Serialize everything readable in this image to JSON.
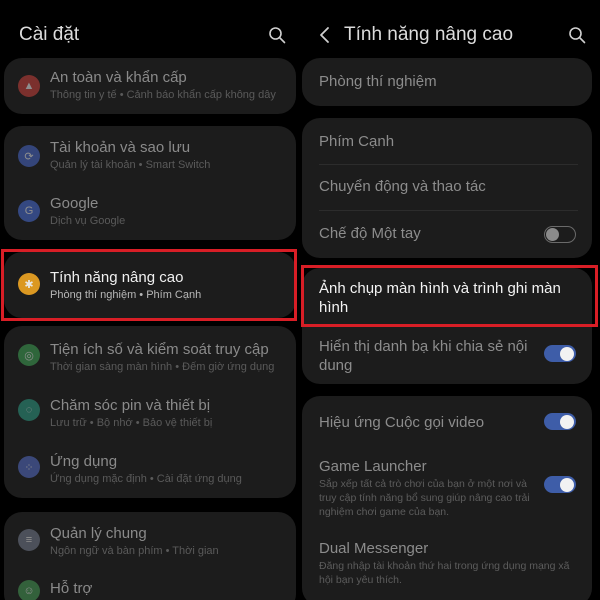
{
  "left": {
    "title": "Cài đặt",
    "items": [
      {
        "title": "An toàn và khẩn cấp",
        "subtitle": "Thông tin y tế  •  Cảnh báo khẩn cấp không dây",
        "icon": "alert-icon",
        "color": "#d9453e"
      },
      {
        "title": "Tài khoản và sao lưu",
        "subtitle": "Quản lý tài khoản  •  Smart Switch",
        "icon": "sync-icon",
        "color": "#4c6ed8"
      },
      {
        "title": "Google",
        "subtitle": "Dịch vụ Google",
        "icon": "google-icon",
        "color": "#4d74e6"
      },
      {
        "title": "Tính năng nâng cao",
        "subtitle": "Phòng thí nghiệm  •  Phím Cạnh",
        "icon": "gear-plus-icon",
        "color": "#f0a623"
      },
      {
        "title": "Tiện ích số và kiểm soát truy cập",
        "subtitle": "Thời gian sàng màn hình  •  Đếm giờ ứng dụng",
        "icon": "wellbeing-icon",
        "color": "#42b05a"
      },
      {
        "title": "Chăm sóc pin và thiết bị",
        "subtitle": "Lưu trữ  •  Bộ nhớ  •  Bảo vệ thiết bị",
        "icon": "device-care-icon",
        "color": "#2fa58d"
      },
      {
        "title": "Ứng dụng",
        "subtitle": "Ứng dụng mặc định  •  Cài đặt ứng dụng",
        "icon": "apps-icon",
        "color": "#5b74d6"
      },
      {
        "title": "Quản lý chung",
        "subtitle": "Ngôn ngữ và bàn phím  •  Thời gian",
        "icon": "sliders-icon",
        "color": "#7d8599"
      },
      {
        "title": "Hỗ trợ",
        "subtitle": "",
        "icon": "accessibility-icon",
        "color": "#4aa65a"
      }
    ]
  },
  "right": {
    "title": "Tính năng nâng cao",
    "items": [
      {
        "title": "Phòng thí nghiệm"
      },
      {
        "title": "Phím Cạnh"
      },
      {
        "title": "Chuyển động và thao tác"
      },
      {
        "title": "Chế độ Một tay",
        "toggle": "off"
      },
      {
        "title": "Ảnh chụp màn hình và trình ghi màn hình"
      },
      {
        "title": "Hiển thị danh bạ khi chia sẻ nội dung",
        "toggle": "on"
      },
      {
        "title": "Hiệu ứng Cuộc gọi video",
        "toggle": "on"
      },
      {
        "title": "Game Launcher",
        "subtitle": "Sắp xếp tất cả trò chơi của bạn ở một nơi và truy cập tính năng bổ sung giúp nâng cao trải nghiệm chơi game của bạn.",
        "toggle": "on"
      },
      {
        "title": "Dual Messenger",
        "subtitle": "Đăng nhập tài khoản thứ hai trong ứng dụng mạng xã hội bạn yêu thích."
      }
    ]
  },
  "colors": {
    "highlight": "#d81e26",
    "toggle_on": "#3e5da8",
    "card": "#1c1c1c"
  }
}
